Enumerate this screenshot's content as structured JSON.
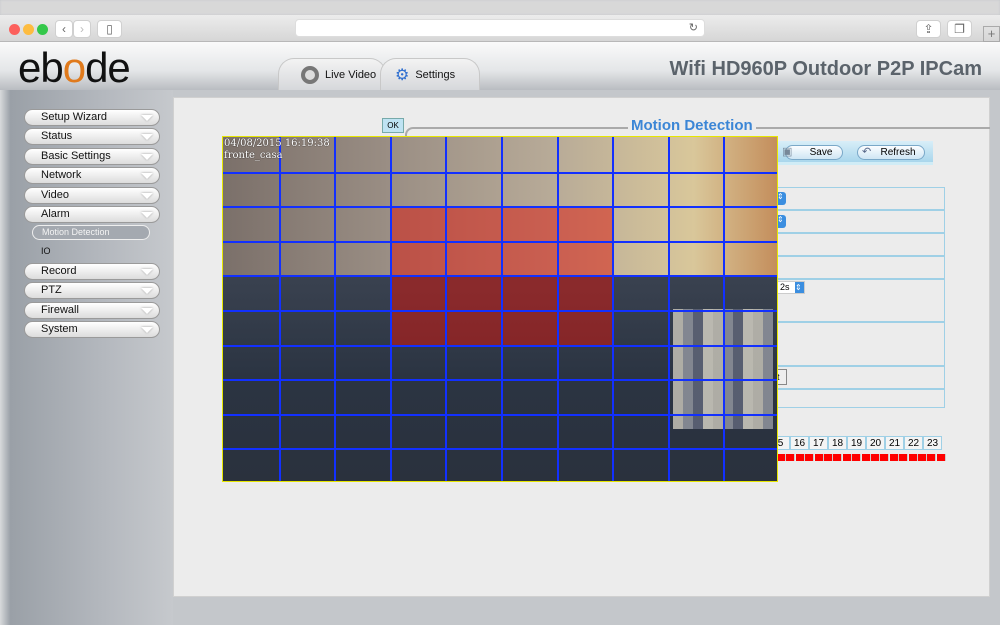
{
  "browser": {
    "back": "‹",
    "forward": "›",
    "sidebar": "▯",
    "reload": "↻",
    "share": "⇪",
    "tabs": "❐",
    "new_tab": "+"
  },
  "header": {
    "logo": "ebode",
    "product": "Wifi HD960P Outdoor P2P IPCam",
    "tabs": [
      {
        "label": "Live Video",
        "icon": "webcam-icon"
      },
      {
        "label": "Settings",
        "icon": "gears-wrench-icon"
      }
    ]
  },
  "sidebar": {
    "items": [
      {
        "label": "Setup Wizard"
      },
      {
        "label": "Status"
      },
      {
        "label": "Basic Settings"
      },
      {
        "label": "Network"
      },
      {
        "label": "Video"
      },
      {
        "label": "Alarm"
      },
      {
        "label": "Motion Detection",
        "sub": true,
        "selected": true
      },
      {
        "label": "IO",
        "sub": true
      },
      {
        "label": "Record"
      },
      {
        "label": "PTZ"
      },
      {
        "label": "Firewall"
      },
      {
        "label": "System"
      }
    ]
  },
  "main": {
    "title": "Motion Detection",
    "ok": "OK",
    "save": "Save",
    "refresh": "Refresh",
    "interval": "2s",
    "partial_button": "t",
    "hours": [
      "5",
      "16",
      "17",
      "18",
      "19",
      "20",
      "21",
      "22",
      "23"
    ]
  },
  "video": {
    "timestamp": "04/08/2015 16:19:38",
    "camera_name": "fronte_casa",
    "grid": {
      "columns": 10,
      "rows": 10
    },
    "selected_area": {
      "columns": [
        3,
        4,
        5,
        6
      ],
      "rows": [
        2,
        3,
        4,
        5
      ]
    }
  },
  "colors": {
    "accent": "#3b86d6",
    "grid": "#1230ff",
    "selection": "#dc140a",
    "schedule": "#ff0000"
  }
}
